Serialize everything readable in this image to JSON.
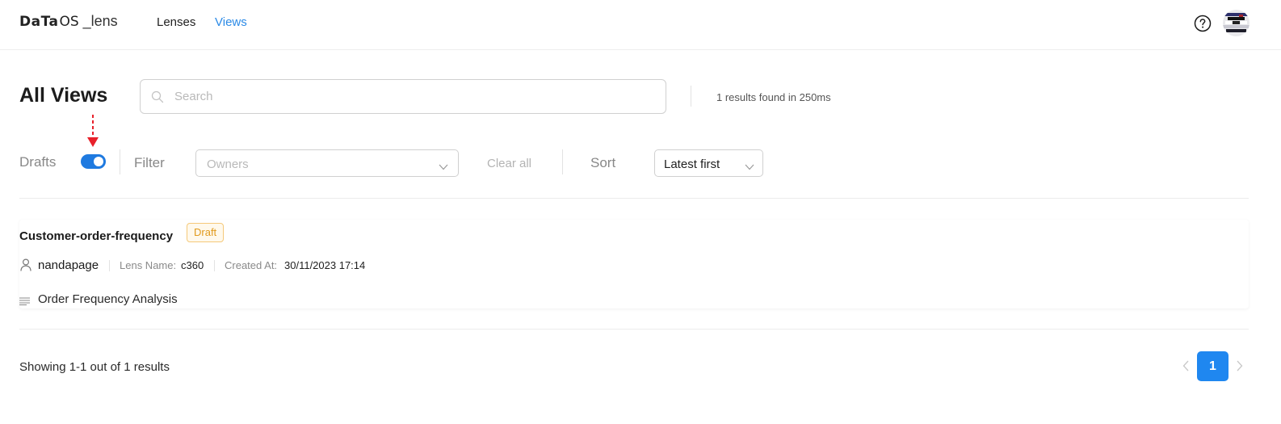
{
  "nav": {
    "logo_brand": "DaTa",
    "logo_os": "OS",
    "logo_product": "_lens",
    "links": [
      {
        "label": "Lenses",
        "active": false
      },
      {
        "label": "Views",
        "active": true
      }
    ],
    "help_icon": "question-circle-icon",
    "avatar": "user-avatar"
  },
  "header": {
    "title": "All Views",
    "search_placeholder": "Search",
    "results_text": "1 results found in 250ms"
  },
  "filters": {
    "drafts_label": "Drafts",
    "drafts_enabled": true,
    "filter_label": "Filter",
    "owners_placeholder": "Owners",
    "clear_all_label": "Clear all",
    "sort_label": "Sort",
    "sort_value": "Latest first"
  },
  "results": [
    {
      "title": "Customer-order-frequency",
      "badge": "Draft",
      "owner": "nandapage",
      "lens_name_key": "Lens Name:",
      "lens_name_value": "c360",
      "created_at_key": "Created At:",
      "created_at_value": "30/11/2023 17:14",
      "description": "Order Frequency Analysis"
    }
  ],
  "footer": {
    "showing_text": "Showing 1-1 out of 1 results",
    "current_page": "1"
  },
  "colors": {
    "accent": "#1f87f0",
    "active_nav": "#2b8ae6",
    "draft_badge_text": "#e19a1d",
    "annotation_arrow": "#e8212b"
  }
}
